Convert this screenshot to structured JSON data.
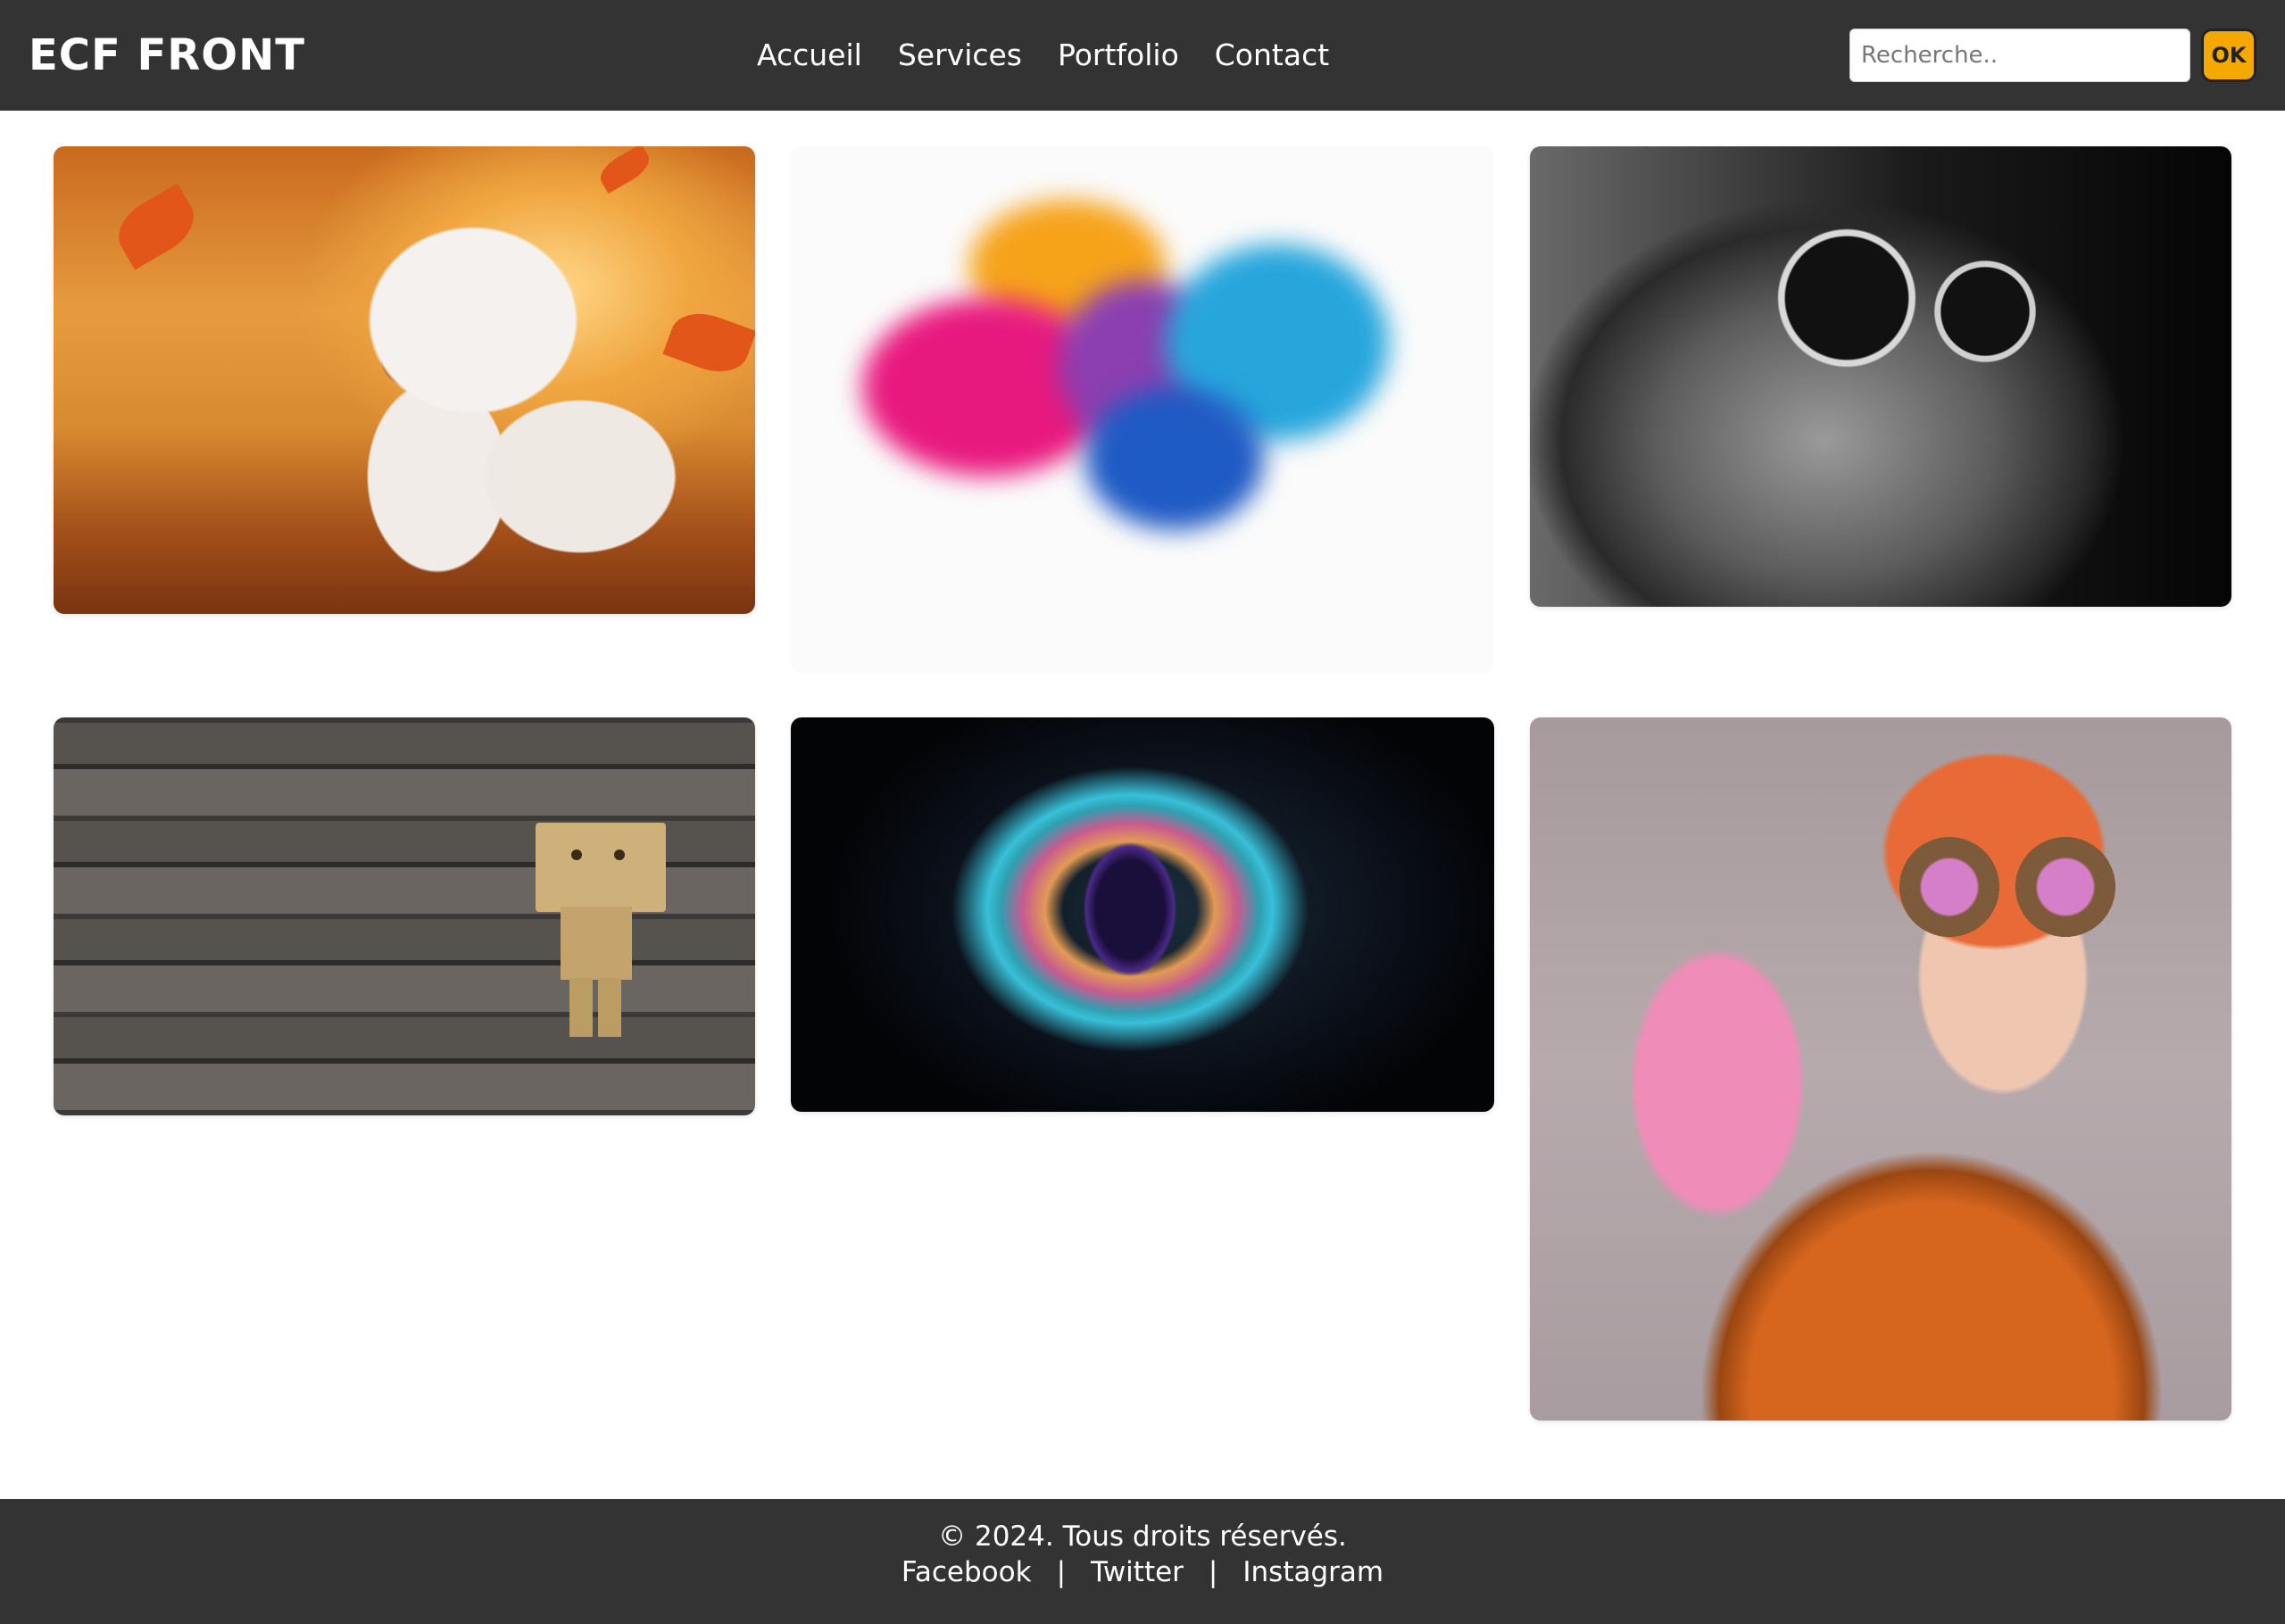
{
  "header": {
    "logo": "ECF FRONT",
    "nav": [
      "Accueil",
      "Services",
      "Portfolio",
      "Contact"
    ],
    "search": {
      "placeholder": "Recherche..",
      "button_label": "OK"
    }
  },
  "gallery": [
    {
      "subject": "fox-kitten-autumn"
    },
    {
      "subject": "color-powder-explosion"
    },
    {
      "subject": "cat-sunglasses"
    },
    {
      "subject": "danbo-figure-wood"
    },
    {
      "subject": "iridescent-eye-particles"
    },
    {
      "subject": "steampunk-goggles-portrait"
    }
  ],
  "footer": {
    "copyright": "© 2024. Tous droits réservés.",
    "links": [
      "Facebook",
      "Twitter",
      "Instagram"
    ],
    "separator": "|"
  },
  "colors": {
    "bar_bg": "#333333",
    "accent": "#f5a800",
    "text": "#ffffff"
  }
}
